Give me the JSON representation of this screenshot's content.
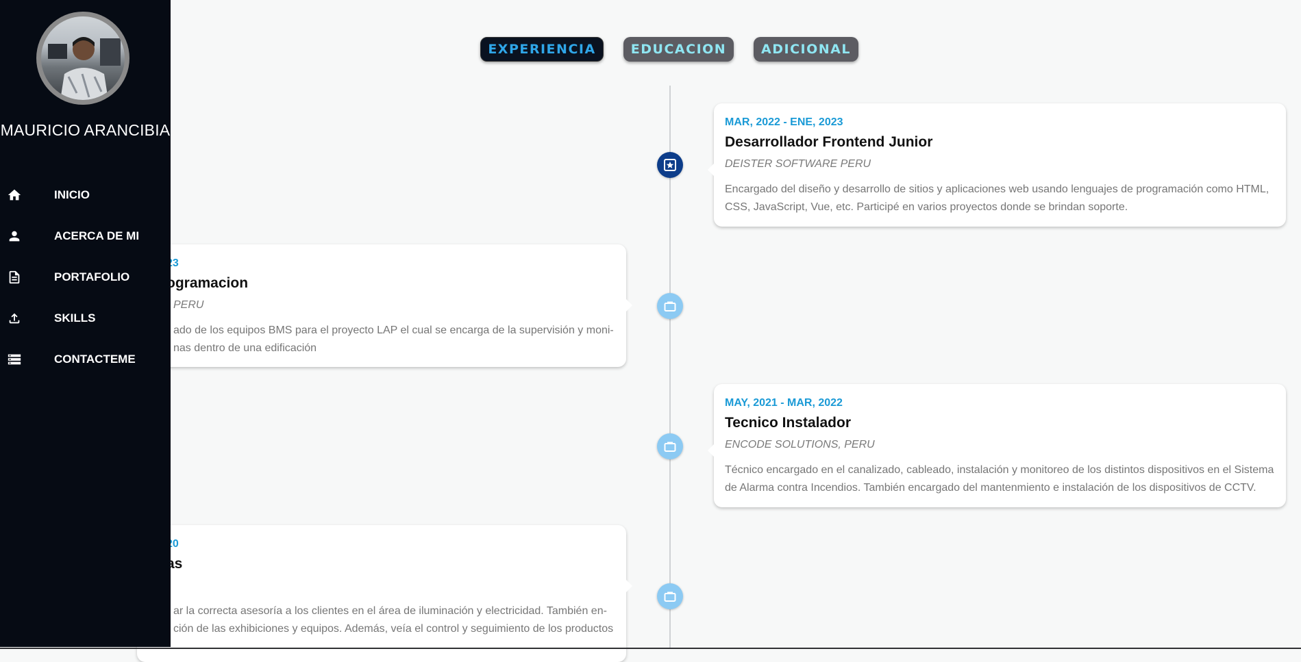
{
  "tabs": [
    {
      "label": "EXPERIENCIA",
      "active": true
    },
    {
      "label": "EDUCACION",
      "active": false
    },
    {
      "label": "ADICIONAL",
      "active": false
    }
  ],
  "sidebar": {
    "name": "MAURICIO ARANCIBIA",
    "items": [
      {
        "label": "INICIO",
        "icon": "home-icon"
      },
      {
        "label": "ACERCA DE MI",
        "icon": "person-icon"
      },
      {
        "label": "PORTAFOLIO",
        "icon": "document-icon"
      },
      {
        "label": "SKILLS",
        "icon": "upload-icon"
      },
      {
        "label": "CONTACTEME",
        "icon": "storage-icon"
      }
    ]
  },
  "timeline": [
    {
      "date": "MAR, 2022 - ENE, 2023",
      "title": "Desarrollador Frontend Junior",
      "company": "DEISTER SOFTWARE PERU",
      "desc_line1": "Encargado del diseño y desarrollo de sitios y aplicaciones web usando lenguajes de programación como HTML,",
      "desc_line2": "CSS, JavaScript, Vue, etc. Participé en varios proyectos donde se brindan soporte.",
      "icon": "star-badge-icon"
    },
    {
      "date": "23",
      "title": "ogramacion",
      "company": "PERU",
      "desc_line1": "ado de los equipos BMS para el proyecto LAP el cual se encarga de la supervisión y moni-",
      "desc_line2": "nas dentro de una edificación",
      "icon": "briefcase-icon"
    },
    {
      "date": "MAY, 2021 - MAR, 2022",
      "title": "Tecnico Instalador",
      "company": "ENCODE SOLUTIONS, PERU",
      "desc_line1": "Técnico encargado en el canalizado, cableado, instalación y monitoreo de los distintos dispositivos en el Sistema",
      "desc_line2": "de Alarma contra Incendios. También encargado del mantenmiento e instalación de los dispositivos de CCTV.",
      "icon": "briefcase-icon"
    },
    {
      "date": "20",
      "title": "as",
      "company": "",
      "desc_line1": "ar la correcta asesoría a los clientes en el área de iluminación y electricidad. También en-",
      "desc_line2": "ción de las exhibiciones y equipos. Además, veía el control y seguimiento de los productos",
      "icon": "briefcase-icon"
    }
  ]
}
